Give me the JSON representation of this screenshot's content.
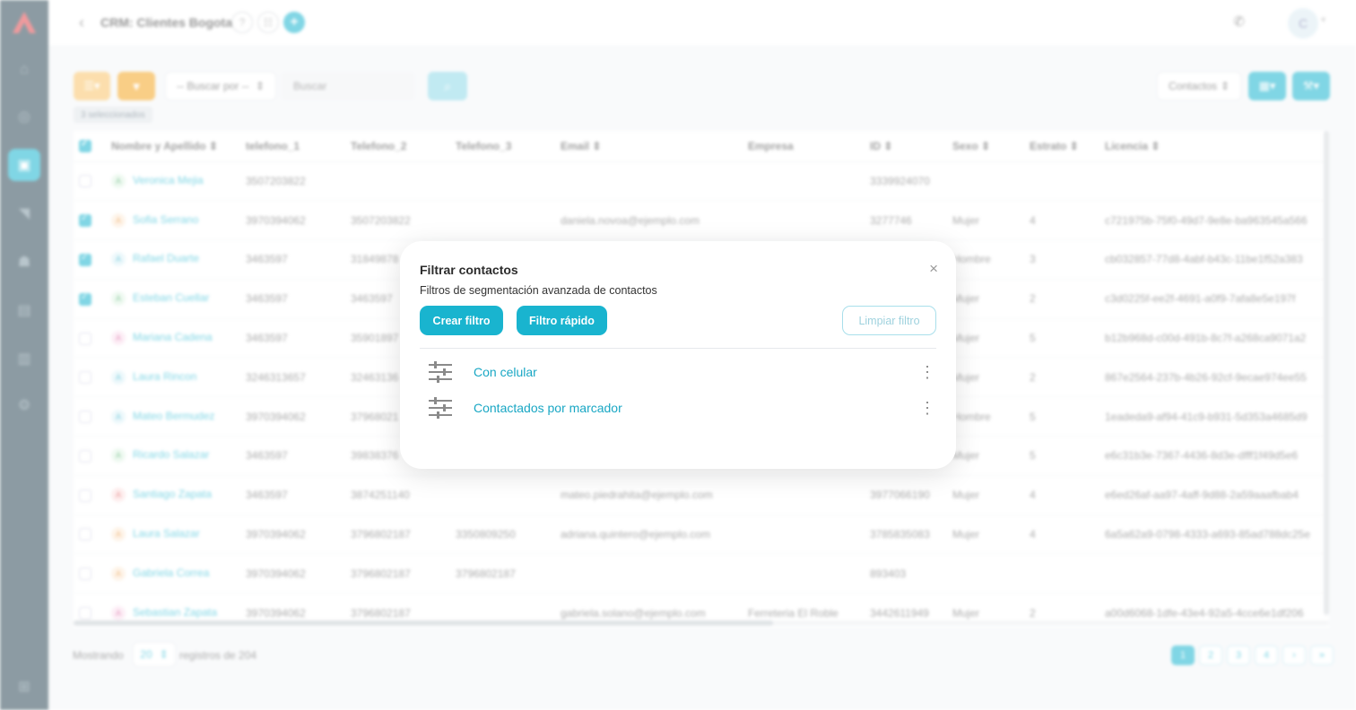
{
  "header": {
    "title": "CRM: Clientes Bogota",
    "avatar_initial": "C"
  },
  "toolbar": {
    "search_by_label": "-- Buscar por --",
    "search_placeholder": "Buscar",
    "selected_badge": "3 seleccionados",
    "entity_select": "Contactos"
  },
  "table": {
    "columns": [
      "Nombre y Apellido",
      "telefono_1",
      "Telefono_2",
      "Telefono_3",
      "Email",
      "Empresa",
      "ID",
      "Sexo",
      "Estrato",
      "Licencia"
    ],
    "rows": [
      {
        "checked": false,
        "initial": "A",
        "name": "Veronica Mejia",
        "t1": "3507203822",
        "t2": "",
        "t3": "",
        "email": "",
        "empresa": "",
        "id": "3339924070",
        "sexo": "",
        "estrato": "",
        "licencia": ""
      },
      {
        "checked": true,
        "initial": "A",
        "name": "Sofia Serrano",
        "t1": "3970394062",
        "t2": "3507203822",
        "t3": "",
        "email": "daniela.novoa@ejemplo.com",
        "empresa": "",
        "id": "3277746",
        "sexo": "Mujer",
        "estrato": "4",
        "licencia": "c721975b-75f0-49d7-9e8e-ba963545a566"
      },
      {
        "checked": true,
        "initial": "A",
        "name": "Rafael Duarte",
        "t1": "3463597",
        "t2": "31849878",
        "t3": "",
        "email": "",
        "empresa": "",
        "id": "",
        "sexo": "Hombre",
        "estrato": "3",
        "licencia": "cb032857-77d8-4abf-b43c-11be1f52a383"
      },
      {
        "checked": true,
        "initial": "A",
        "name": "Esteban Cuellar",
        "t1": "3463597",
        "t2": "3463597",
        "t3": "",
        "email": "",
        "empresa": "",
        "id": "",
        "sexo": "Mujer",
        "estrato": "2",
        "licencia": "c3d0225f-ee2f-4691-a0f9-7afa8e5e197f"
      },
      {
        "checked": false,
        "initial": "A",
        "name": "Mariana Cadena",
        "t1": "3463597",
        "t2": "35901897",
        "t3": "",
        "email": "",
        "empresa": "",
        "id": "",
        "sexo": "Mujer",
        "estrato": "5",
        "licencia": "b12b968d-c00d-491b-8c7f-a268ca9071a2"
      },
      {
        "checked": false,
        "initial": "A",
        "name": "Laura Rincon",
        "t1": "3246313657",
        "t2": "32463136",
        "t3": "",
        "email": "",
        "empresa": "",
        "id": "",
        "sexo": "Mujer",
        "estrato": "2",
        "licencia": "867e2564-237b-4b26-92cf-9ecae974ee55"
      },
      {
        "checked": false,
        "initial": "A",
        "name": "Mateo Bermudez",
        "t1": "3970394062",
        "t2": "37968021",
        "t3": "",
        "email": "",
        "empresa": "",
        "id": "",
        "sexo": "Hombre",
        "estrato": "5",
        "licencia": "1eadeda9-af94-41c9-b931-5d353a4685d9"
      },
      {
        "checked": false,
        "initial": "A",
        "name": "Ricardo Salazar",
        "t1": "3463597",
        "t2": "39838376",
        "t3": "",
        "email": "",
        "empresa": "",
        "id": "",
        "sexo": "Mujer",
        "estrato": "5",
        "licencia": "e6c31b3e-7367-4436-8d3e-dfff1f49d5e6"
      },
      {
        "checked": false,
        "initial": "A",
        "name": "Santiago Zapata",
        "t1": "3463597",
        "t2": "3874251140",
        "t3": "",
        "email": "mateo.piedrahita@ejemplo.com",
        "empresa": "",
        "id": "3977066190",
        "sexo": "Mujer",
        "estrato": "4",
        "licencia": "e6ed26af-aa97-4aff-9d88-2a59aaafbab4"
      },
      {
        "checked": false,
        "initial": "A",
        "name": "Laura Salazar",
        "t1": "3970394062",
        "t2": "3796802187",
        "t3": "3350809250",
        "email": "adriana.quintero@ejemplo.com",
        "empresa": "",
        "id": "3785835083",
        "sexo": "Mujer",
        "estrato": "4",
        "licencia": "6a5a62a9-0798-4333-a693-85ad788dc25e"
      },
      {
        "checked": false,
        "initial": "A",
        "name": "Gabriela Correa",
        "t1": "3970394062",
        "t2": "3796802187",
        "t3": "3796802187",
        "email": "",
        "empresa": "",
        "id": "893403",
        "sexo": "",
        "estrato": "",
        "licencia": ""
      },
      {
        "checked": false,
        "initial": "A",
        "name": "Sebastian Zapata",
        "t1": "3970394062",
        "t2": "3796802187",
        "t3": "",
        "email": "gabriela.solano@ejemplo.com",
        "empresa": "Ferreteria El Roble",
        "id": "3442611949",
        "sexo": "Mujer",
        "estrato": "2",
        "licencia": "a00d6068-1dfe-43e4-92a5-4cce6e1df206"
      }
    ]
  },
  "footer": {
    "showing_label": "Mostrando",
    "page_size": "20",
    "records_label": "registros de 204",
    "pages": [
      "1",
      "2",
      "3",
      "4",
      "›",
      "»"
    ]
  },
  "modal": {
    "title": "Filtrar contactos",
    "subtitle": "Filtros de segmentación avanzada de contactos",
    "create_filter": "Crear filtro",
    "quick_filter": "Filtro rápido",
    "clear_filter": "Limpiar filtro",
    "filters": [
      {
        "name": "Con celular"
      },
      {
        "name": "Contactados por marcador"
      }
    ]
  },
  "colors": {
    "accent": "#19b4cf",
    "sidebar": "#2f4a58",
    "orange": "#f5a623"
  }
}
